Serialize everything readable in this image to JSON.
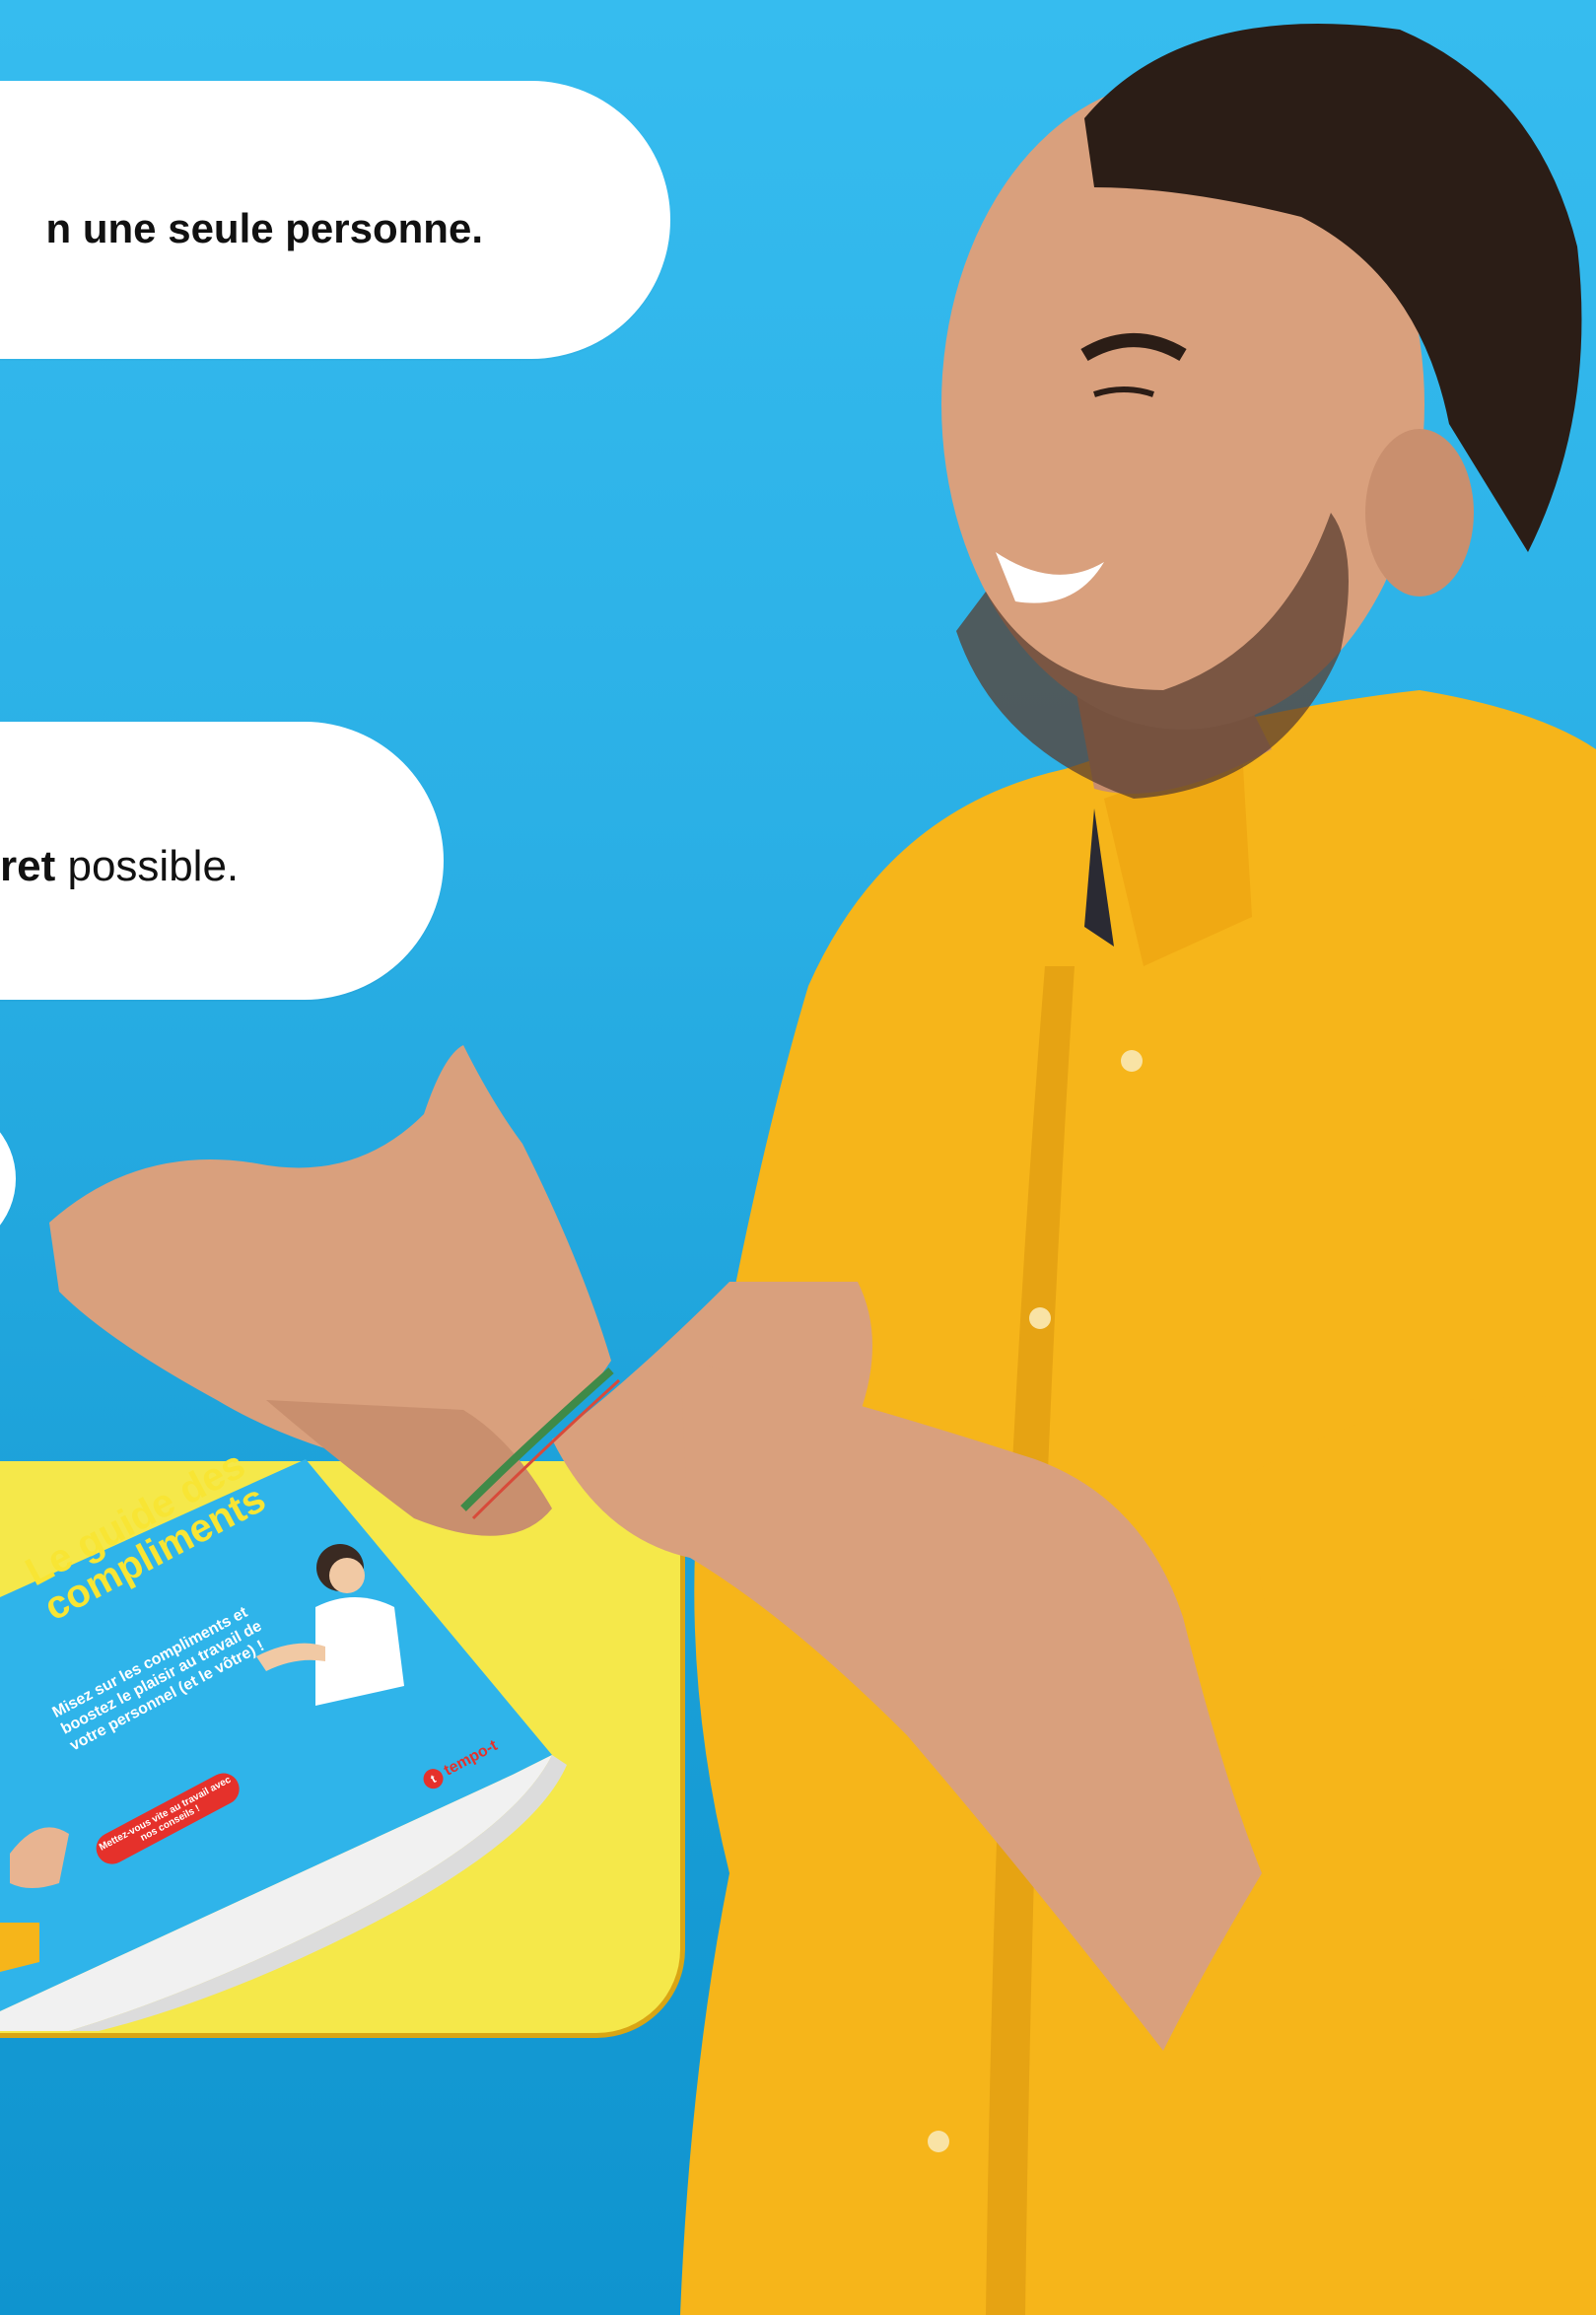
{
  "bubbles": {
    "first_text": "n une seule personne.",
    "second_bold": "ret",
    "second_rest": " possible."
  },
  "guide": {
    "title": "Le guide des compliments",
    "subtitle": "Misez sur les compliments et boostez le plaisir au travail de votre personnel (et le vôtre) !",
    "cta": "Mettez-vous vite au travail avec nos conseils !",
    "logo": "tempo-t"
  },
  "colors": {
    "background_top": "#36bcef",
    "background_bottom": "#0f94cf",
    "shirt": "#f6b51a",
    "card_yellow": "#f5e84a",
    "accent_red": "#e5312b"
  }
}
